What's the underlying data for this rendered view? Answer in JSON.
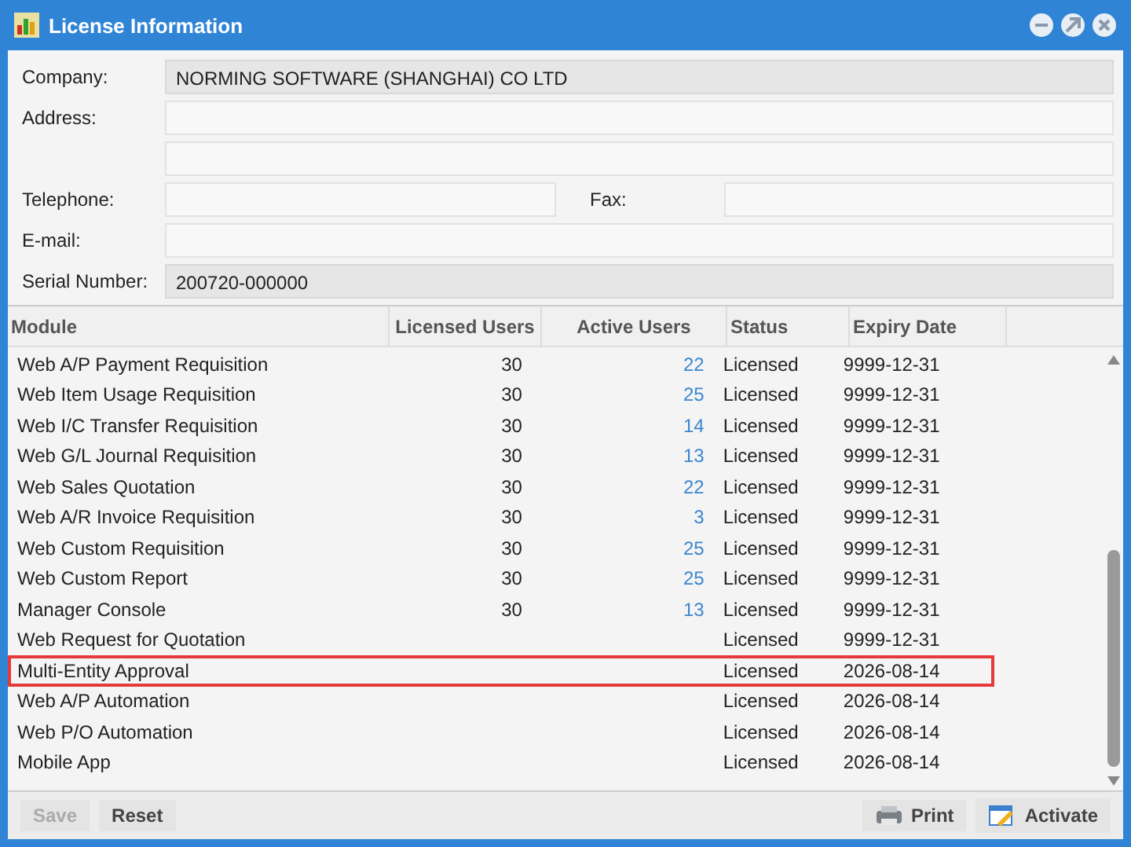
{
  "window": {
    "title": "License Information"
  },
  "form": [
    {
      "label": "Company:",
      "value": "NORMING SOFTWARE (SHANGHAI) CO LTD",
      "readonly": true
    },
    {
      "label": "Address:",
      "readonly": false
    },
    {
      "label": "Telephone:",
      "readonly": false
    },
    {
      "label": "E-mail:",
      "readonly": false
    },
    {
      "label": "Serial Number:",
      "value": "200720-000000",
      "readonly": true
    }
  ],
  "fax": {
    "label": "Fax:"
  },
  "table": {
    "columns": [
      "Module",
      "Licensed Users",
      "Active Users",
      "Status",
      "Expiry Date"
    ],
    "rows": [
      {
        "module": "Web A/P Payment Requisition",
        "licensed": "30",
        "active": "22",
        "status": "Licensed",
        "expiry": "9999-12-31",
        "selected": false
      },
      {
        "module": "Web Item Usage Requisition",
        "licensed": "30",
        "active": "25",
        "status": "Licensed",
        "expiry": "9999-12-31",
        "selected": false
      },
      {
        "module": "Web I/C Transfer Requisition",
        "licensed": "30",
        "active": "14",
        "status": "Licensed",
        "expiry": "9999-12-31",
        "selected": false
      },
      {
        "module": "Web G/L Journal Requisition",
        "licensed": "30",
        "active": "13",
        "status": "Licensed",
        "expiry": "9999-12-31",
        "selected": false
      },
      {
        "module": "Web Sales Quotation",
        "licensed": "30",
        "active": "22",
        "status": "Licensed",
        "expiry": "9999-12-31",
        "selected": false
      },
      {
        "module": "Web A/R Invoice Requisition",
        "licensed": "30",
        "active": "3",
        "status": "Licensed",
        "expiry": "9999-12-31",
        "selected": false
      },
      {
        "module": "Web Custom Requisition",
        "licensed": "30",
        "active": "25",
        "status": "Licensed",
        "expiry": "9999-12-31",
        "selected": false
      },
      {
        "module": "Web Custom Report",
        "licensed": "30",
        "active": "25",
        "status": "Licensed",
        "expiry": "9999-12-31",
        "selected": false
      },
      {
        "module": "Manager Console",
        "licensed": "30",
        "active": "13",
        "status": "Licensed",
        "expiry": "9999-12-31",
        "selected": false
      },
      {
        "module": "Web Request for Quotation",
        "status": "Licensed",
        "expiry": "9999-12-31",
        "selected": false
      },
      {
        "module": "Multi-Entity Approval",
        "status": "Licensed",
        "expiry": "2026-08-14",
        "selected": true
      },
      {
        "module": "Web A/P Automation",
        "status": "Licensed",
        "expiry": "2026-08-14",
        "selected": false
      },
      {
        "module": "Web P/O Automation",
        "status": "Licensed",
        "expiry": "2026-08-14",
        "selected": false
      },
      {
        "module": "Mobile App",
        "status": "Licensed",
        "expiry": "2026-08-14",
        "selected": false
      }
    ]
  },
  "footer": {
    "left": [
      {
        "label": "Save",
        "disabled": true
      },
      {
        "label": "Reset",
        "disabled": false
      }
    ],
    "print": "Print",
    "activate": "Activate"
  }
}
